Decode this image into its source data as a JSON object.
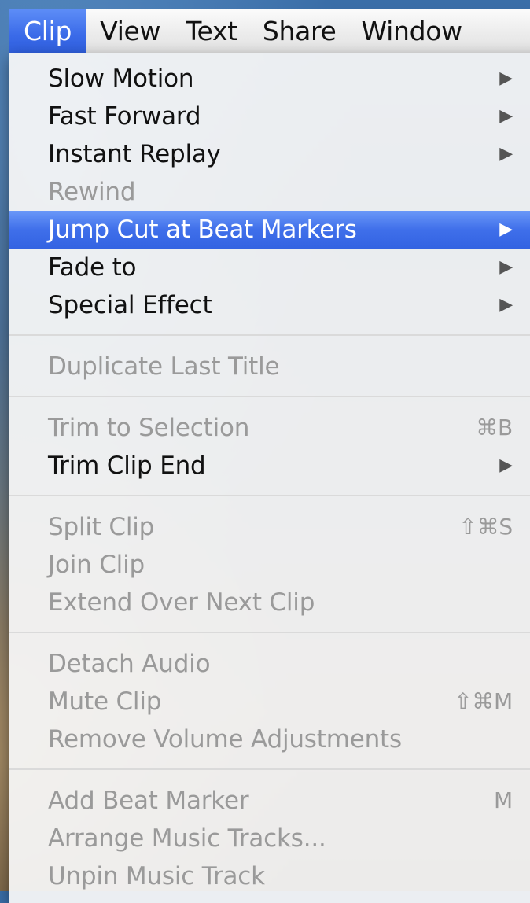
{
  "menubar": {
    "items": [
      {
        "label": "Clip",
        "active": true
      },
      {
        "label": "View",
        "active": false
      },
      {
        "label": "Text",
        "active": false
      },
      {
        "label": "Share",
        "active": false
      },
      {
        "label": "Window",
        "active": false
      }
    ]
  },
  "menu": {
    "groups": [
      [
        {
          "label": "Slow Motion",
          "enabled": true,
          "submenu": true
        },
        {
          "label": "Fast Forward",
          "enabled": true,
          "submenu": true
        },
        {
          "label": "Instant Replay",
          "enabled": true,
          "submenu": true
        },
        {
          "label": "Rewind",
          "enabled": false,
          "submenu": false
        },
        {
          "label": "Jump Cut at Beat Markers",
          "enabled": true,
          "submenu": true,
          "highlighted": true
        },
        {
          "label": "Fade to",
          "enabled": true,
          "submenu": true
        },
        {
          "label": "Special Effect",
          "enabled": true,
          "submenu": true
        }
      ],
      [
        {
          "label": "Duplicate Last Title",
          "enabled": false
        }
      ],
      [
        {
          "label": "Trim to Selection",
          "enabled": false,
          "shortcut": "⌘B"
        },
        {
          "label": "Trim Clip End",
          "enabled": true,
          "submenu": true
        }
      ],
      [
        {
          "label": "Split Clip",
          "enabled": false,
          "shortcut": "⇧⌘S"
        },
        {
          "label": "Join Clip",
          "enabled": false
        },
        {
          "label": "Extend Over Next Clip",
          "enabled": false
        }
      ],
      [
        {
          "label": "Detach Audio",
          "enabled": false
        },
        {
          "label": "Mute Clip",
          "enabled": false,
          "shortcut": "⇧⌘M"
        },
        {
          "label": "Remove Volume Adjustments",
          "enabled": false
        }
      ],
      [
        {
          "label": "Add Beat Marker",
          "enabled": false,
          "shortcut": "M"
        },
        {
          "label": "Arrange Music Tracks...",
          "enabled": false
        },
        {
          "label": "Unpin Music Track",
          "enabled": false
        }
      ]
    ],
    "submenu_arrow_glyph": "▶"
  },
  "colors": {
    "highlight": "#3f6fea",
    "disabled_text": "#9a9a9a",
    "enabled_text": "#111111"
  }
}
